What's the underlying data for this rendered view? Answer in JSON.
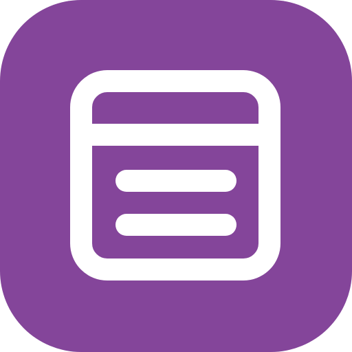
{
  "icon": {
    "name": "document-list-icon",
    "background_color": "#84459a",
    "foreground_color": "#ffffff"
  }
}
